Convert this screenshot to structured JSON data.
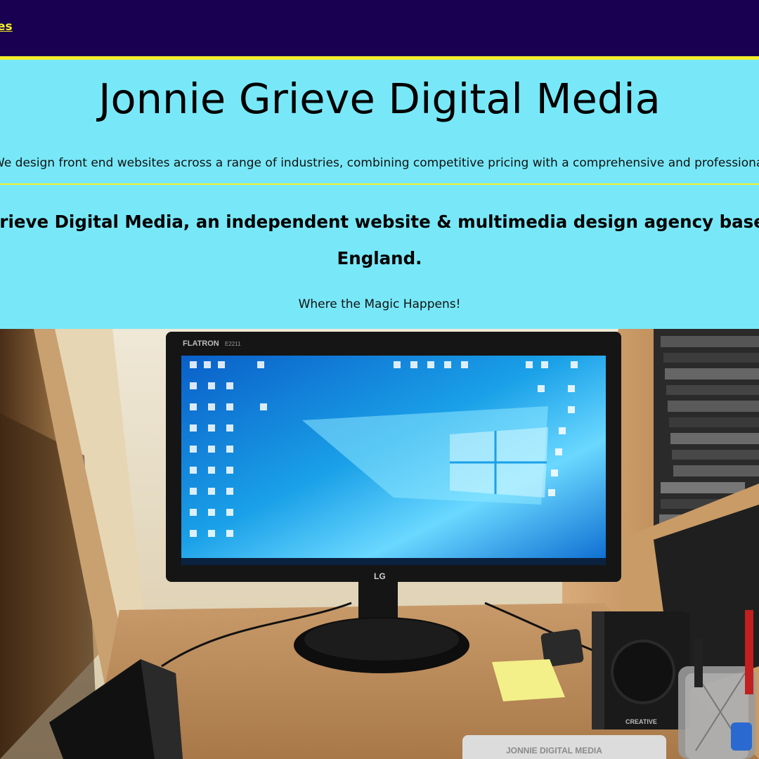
{
  "nav": {
    "link_label": "es"
  },
  "hero": {
    "title": "Jonnie Grieve Digital Media",
    "tagline": "We design front end websites across a range of industries, combining competitive pricing with a comprehensive and professional service.",
    "intro_line1": "Jonnie Grieve Digital Media, an independent website & multimedia design agency based in the",
    "intro_line2": "England.",
    "slogan": "Where the Magic Happens!"
  },
  "photo": {
    "monitor_brand": "FLATRON",
    "monitor_model": "E2211",
    "monitor_maker": "LG",
    "speaker_brand": "CREATIVE",
    "mousepad_text": "JONNIE DIGITAL MEDIA"
  },
  "colors": {
    "nav_bg": "#1a0050",
    "accent_yellow": "#f5f02a",
    "hero_bg": "#78e8f8"
  }
}
